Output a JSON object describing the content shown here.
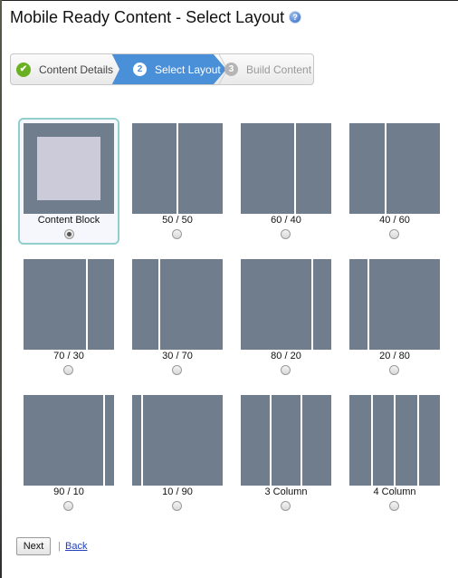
{
  "header": {
    "title": "Mobile Ready Content - Select Layout",
    "help_icon": "help-circle-icon"
  },
  "stepper": {
    "steps": [
      {
        "number": "✔",
        "label": "Content Details",
        "state": "complete",
        "icon": "check-circle-icon"
      },
      {
        "number": "2",
        "label": "Select Layout",
        "state": "active"
      },
      {
        "number": "3",
        "label": "Build Content",
        "state": "upcoming"
      }
    ],
    "colors": {
      "active": "#4a90d9",
      "complete": "#6ab023",
      "upcoming": "#b5b5b5"
    }
  },
  "layouts": [
    {
      "label": "Content Block",
      "columns": [],
      "selected": true
    },
    {
      "label": "50 / 50",
      "columns": [
        50,
        50
      ],
      "selected": false
    },
    {
      "label": "60 / 40",
      "columns": [
        60,
        40
      ],
      "selected": false
    },
    {
      "label": "40 / 60",
      "columns": [
        40,
        60
      ],
      "selected": false
    },
    {
      "label": "70 / 30",
      "columns": [
        70,
        30
      ],
      "selected": false
    },
    {
      "label": "30 / 70",
      "columns": [
        30,
        70
      ],
      "selected": false
    },
    {
      "label": "80 / 20",
      "columns": [
        80,
        20
      ],
      "selected": false
    },
    {
      "label": "20 / 80",
      "columns": [
        20,
        80
      ],
      "selected": false
    },
    {
      "label": "90 / 10",
      "columns": [
        90,
        10
      ],
      "selected": false
    },
    {
      "label": "10 / 90",
      "columns": [
        10,
        90
      ],
      "selected": false
    },
    {
      "label": "3 Column",
      "columns": [
        33,
        33,
        33
      ],
      "selected": false
    },
    {
      "label": "4 Column",
      "columns": [
        25,
        25,
        25,
        25
      ],
      "selected": false
    }
  ],
  "colors": {
    "thumb": "#6f7d8c",
    "block_inner": "#cbcbda",
    "selected_border": "#8fd0cf"
  },
  "footer": {
    "next_label": "Next",
    "separator": "|",
    "back_label": "Back"
  }
}
